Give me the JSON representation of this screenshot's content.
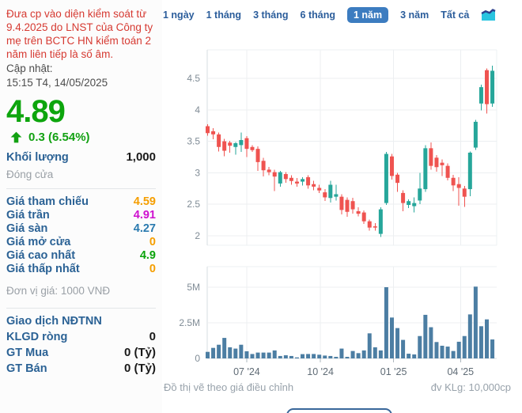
{
  "sidebar": {
    "warning": "Đưa cp vào diện kiểm soát từ 9.4.2025 do LNST của Công ty mẹ trên BCTC HN kiểm toán 2 năm liên tiếp là số âm.",
    "updated_label": "Cập nhật:",
    "updated_value": "15:15 T4, 14/05/2025",
    "price": "4.89",
    "change": "0.3 (6.54%)",
    "volume_label": "Khối lượng",
    "volume_value": "1,000",
    "close_label": "Đóng cửa",
    "price_rows": [
      {
        "label": "Giá tham chiếu",
        "value": "4.59",
        "color": "#f59e00"
      },
      {
        "label": "Giá trần",
        "value": "4.91",
        "color": "#cf10cf"
      },
      {
        "label": "Giá sàn",
        "value": "4.27",
        "color": "#2a7aaf"
      },
      {
        "label": "Giá mở cửa",
        "value": "0",
        "color": "#f59e00"
      },
      {
        "label": "Giá cao nhất",
        "value": "4.9",
        "color": "#0aa30a"
      },
      {
        "label": "Giá thấp nhất",
        "value": "0",
        "color": "#f59e00"
      }
    ],
    "unit_note": "Đơn vị giá: 1000 VNĐ",
    "foreign_title": "Giao dịch NĐTNN",
    "foreign_rows": [
      {
        "label": "KLGD ròng",
        "value": "0"
      },
      {
        "label": "GT Mua",
        "value": "0 (Tỷ)"
      },
      {
        "label": "GT Bán",
        "value": "0 (Tỷ)"
      }
    ]
  },
  "tabs": {
    "items": [
      "1 ngày",
      "1 tháng",
      "3 tháng",
      "6 tháng",
      "1 năm",
      "3 năm",
      "Tất cả"
    ],
    "selected": "1 năm",
    "area_chart_icon": "area-chart-icon"
  },
  "footer": {
    "left": "Đồ thị vẽ theo giá điều chỉnh",
    "right": "đv KLg: 10,000cp"
  },
  "chart_data": {
    "type": "candlestick+volume",
    "up_color": "#26a69a",
    "down_color": "#ef5350",
    "volume_color": "#4c7ea3",
    "price_ticks": [
      4.5,
      4,
      3.5,
      3,
      2.5,
      2
    ],
    "volume_ticks": [
      {
        "label": "5M",
        "value": 5
      },
      {
        "label": "2.5M",
        "value": 2.5
      },
      {
        "label": "0",
        "value": 0
      }
    ],
    "x_labels": [
      {
        "label": "07 '24",
        "pos": 7.0
      },
      {
        "label": "10 '24",
        "pos": 20.2
      },
      {
        "label": "01 '25",
        "pos": 33.3
      },
      {
        "label": "04 '25",
        "pos": 45.3
      }
    ],
    "candles_ohlc": [
      [
        3.74,
        3.77,
        3.59,
        3.63
      ],
      [
        3.66,
        3.71,
        3.53,
        3.61
      ],
      [
        3.61,
        3.64,
        3.34,
        3.41
      ],
      [
        3.5,
        3.54,
        3.26,
        3.35
      ],
      [
        3.48,
        3.51,
        3.32,
        3.43
      ],
      [
        3.41,
        3.49,
        3.29,
        3.47
      ],
      [
        3.44,
        3.64,
        3.33,
        3.52
      ],
      [
        3.55,
        3.58,
        3.25,
        3.38
      ],
      [
        3.41,
        3.44,
        3.33,
        3.36
      ],
      [
        3.38,
        3.42,
        3.03,
        3.17
      ],
      [
        3.19,
        3.24,
        2.94,
        3.04
      ],
      [
        3.05,
        3.09,
        2.96,
        3.01
      ],
      [
        3.01,
        3.05,
        2.71,
        2.94
      ],
      [
        2.83,
        3.03,
        2.78,
        3.01
      ],
      [
        2.98,
        3.01,
        2.84,
        2.9
      ],
      [
        2.92,
        2.96,
        2.81,
        2.87
      ],
      [
        2.86,
        2.92,
        2.78,
        2.83
      ],
      [
        2.86,
        2.93,
        2.8,
        2.9
      ],
      [
        2.93,
        2.96,
        2.75,
        2.8
      ],
      [
        2.82,
        2.87,
        2.72,
        2.78
      ],
      [
        2.76,
        2.81,
        2.68,
        2.72
      ],
      [
        2.69,
        2.74,
        2.55,
        2.61
      ],
      [
        2.6,
        2.87,
        2.53,
        2.81
      ],
      [
        2.62,
        2.81,
        2.56,
        2.66
      ],
      [
        2.62,
        2.66,
        2.34,
        2.41
      ],
      [
        2.57,
        2.61,
        2.3,
        2.38
      ],
      [
        2.55,
        2.6,
        2.35,
        2.42
      ],
      [
        2.39,
        2.45,
        2.31,
        2.35
      ],
      [
        2.37,
        2.4,
        2.19,
        2.23
      ],
      [
        2.23,
        2.26,
        2.08,
        2.13
      ],
      [
        2.15,
        2.2,
        2.08,
        2.13
      ],
      [
        2.03,
        2.45,
        1.98,
        2.42
      ],
      [
        2.52,
        3.33,
        2.49,
        3.3
      ],
      [
        3.26,
        3.3,
        2.89,
        2.95
      ],
      [
        2.97,
        3.0,
        2.7,
        2.84
      ],
      [
        2.68,
        2.72,
        2.39,
        2.52
      ],
      [
        2.49,
        2.58,
        2.44,
        2.55
      ],
      [
        2.47,
        2.61,
        2.37,
        2.52
      ],
      [
        2.56,
        3.0,
        2.5,
        2.75
      ],
      [
        2.74,
        3.44,
        2.7,
        3.39
      ],
      [
        3.39,
        3.48,
        3.05,
        3.11
      ],
      [
        3.24,
        3.28,
        3.02,
        3.09
      ],
      [
        3.16,
        3.21,
        2.95,
        3.12
      ],
      [
        3.11,
        3.15,
        2.88,
        2.92
      ],
      [
        2.92,
        2.97,
        2.71,
        2.8
      ],
      [
        2.82,
        2.93,
        2.48,
        2.76
      ],
      [
        2.75,
        2.79,
        2.46,
        2.62
      ],
      [
        2.74,
        3.34,
        2.63,
        3.32
      ],
      [
        3.4,
        3.84,
        3.36,
        3.81
      ],
      [
        4.1,
        4.4,
        3.99,
        4.36
      ],
      [
        4.63,
        4.66,
        3.94,
        4.09
      ],
      [
        4.1,
        4.7,
        4.05,
        4.62
      ]
    ],
    "volumes_m": [
      0.46,
      0.74,
      0.96,
      1.44,
      0.78,
      0.69,
      0.96,
      0.5,
      0.31,
      0.41,
      0.41,
      0.41,
      0.56,
      0.17,
      0.22,
      0.17,
      0.07,
      0.3,
      0.31,
      0.31,
      0.26,
      0.2,
      0.17,
      0.11,
      0.69,
      0.11,
      0.52,
      0.37,
      0.56,
      1.76,
      0.78,
      0.56,
      5.0,
      2.87,
      2.13,
      1.3,
      0.33,
      0.28,
      1.57,
      3.06,
      2.19,
      1.15,
      0.89,
      0.83,
      0.52,
      1.17,
      1.57,
      3.09,
      5.04,
      2.26,
      2.74,
      1.33
    ]
  }
}
